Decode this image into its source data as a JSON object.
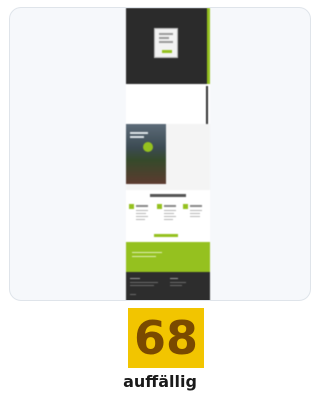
{
  "result": {
    "score": "68",
    "rating": "auffällig"
  },
  "colors": {
    "accent": "#95c11f",
    "score_badge": "#f2c500",
    "score_text": "#7a4a00"
  }
}
